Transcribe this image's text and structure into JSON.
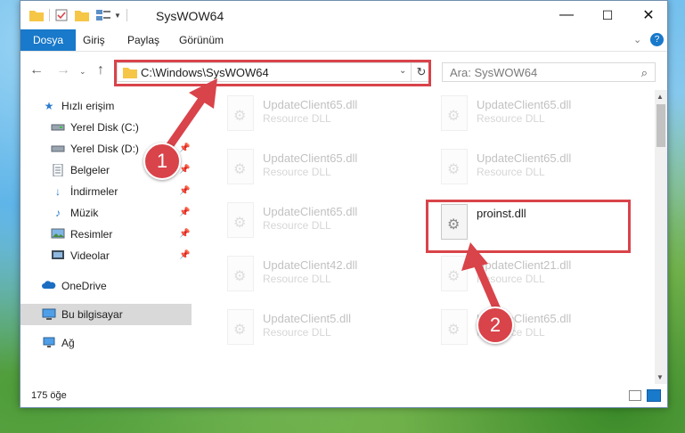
{
  "window": {
    "title": "SysWOW64",
    "minimize": "—",
    "maximize": "☐",
    "close": "✕"
  },
  "ribbon": {
    "tabs": [
      "Dosya",
      "Giriş",
      "Paylaş",
      "Görünüm"
    ]
  },
  "address": {
    "path": "C:\\Windows\\SysWOW64"
  },
  "search": {
    "placeholder": "Ara: SysWOW64"
  },
  "sidebar": {
    "items": [
      {
        "label": "Hızlı erişim",
        "icon": "star-icon",
        "pinned": false
      },
      {
        "label": "Yerel Disk (C:)",
        "icon": "drive-icon",
        "pinned": false
      },
      {
        "label": "Yerel Disk (D:)",
        "icon": "drive-icon",
        "pinned": true
      },
      {
        "label": "Belgeler",
        "icon": "documents-icon",
        "pinned": true
      },
      {
        "label": "İndirmeler",
        "icon": "download-icon",
        "pinned": true
      },
      {
        "label": "Müzik",
        "icon": "music-icon",
        "pinned": true
      },
      {
        "label": "Resimler",
        "icon": "pictures-icon",
        "pinned": true
      },
      {
        "label": "Videolar",
        "icon": "video-icon",
        "pinned": true
      },
      {
        "label": "OneDrive",
        "icon": "cloud-icon",
        "pinned": false
      },
      {
        "label": "Bu bilgisayar",
        "icon": "computer-icon",
        "pinned": false
      },
      {
        "label": "Ağ",
        "icon": "network-icon",
        "pinned": false
      }
    ]
  },
  "files": [
    {
      "name": "UpdateClient65.dll",
      "type": "Resource DLL"
    },
    {
      "name": "UpdateClient65.dll",
      "type": "Resource DLL"
    },
    {
      "name": "UpdateClient65.dll",
      "type": "Resource DLL"
    },
    {
      "name": "UpdateClient65.dll",
      "type": "Resource DLL"
    },
    {
      "name": "UpdateClient65.dll",
      "type": "Resource DLL"
    },
    {
      "name": "proinst.dll",
      "type": ""
    },
    {
      "name": "UpdateClient42.dll",
      "type": "Resource DLL"
    },
    {
      "name": "UpdateClient21.dll",
      "type": "Resource DLL"
    },
    {
      "name": "UpdateClient5.dll",
      "type": "Resource DLL"
    },
    {
      "name": "UpdateClient65.dll",
      "type": "Resource DLL"
    }
  ],
  "status": {
    "count": "175 öğe"
  },
  "annotations": {
    "step1": "1",
    "step2": "2",
    "color": "#d9434a"
  }
}
